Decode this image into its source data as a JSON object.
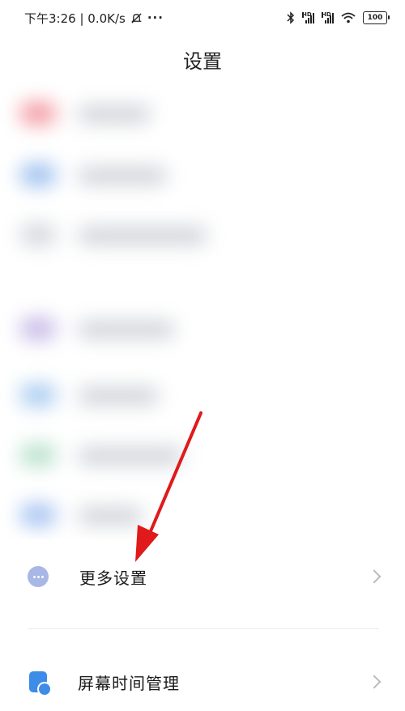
{
  "status_bar": {
    "time_speed": "下午3:26 | 0.0K/s",
    "more": "···",
    "hd1": "HD",
    "hd2": "HD",
    "battery": "100"
  },
  "page": {
    "title": "设置"
  },
  "settings": {
    "items": [
      {
        "label": "更多设置"
      },
      {
        "label": "屏幕时间管理"
      }
    ]
  },
  "colors": {
    "more_icon": "#a9b7e6",
    "screen_icon": "#3d8ce8",
    "arrow": "#e0191b"
  }
}
